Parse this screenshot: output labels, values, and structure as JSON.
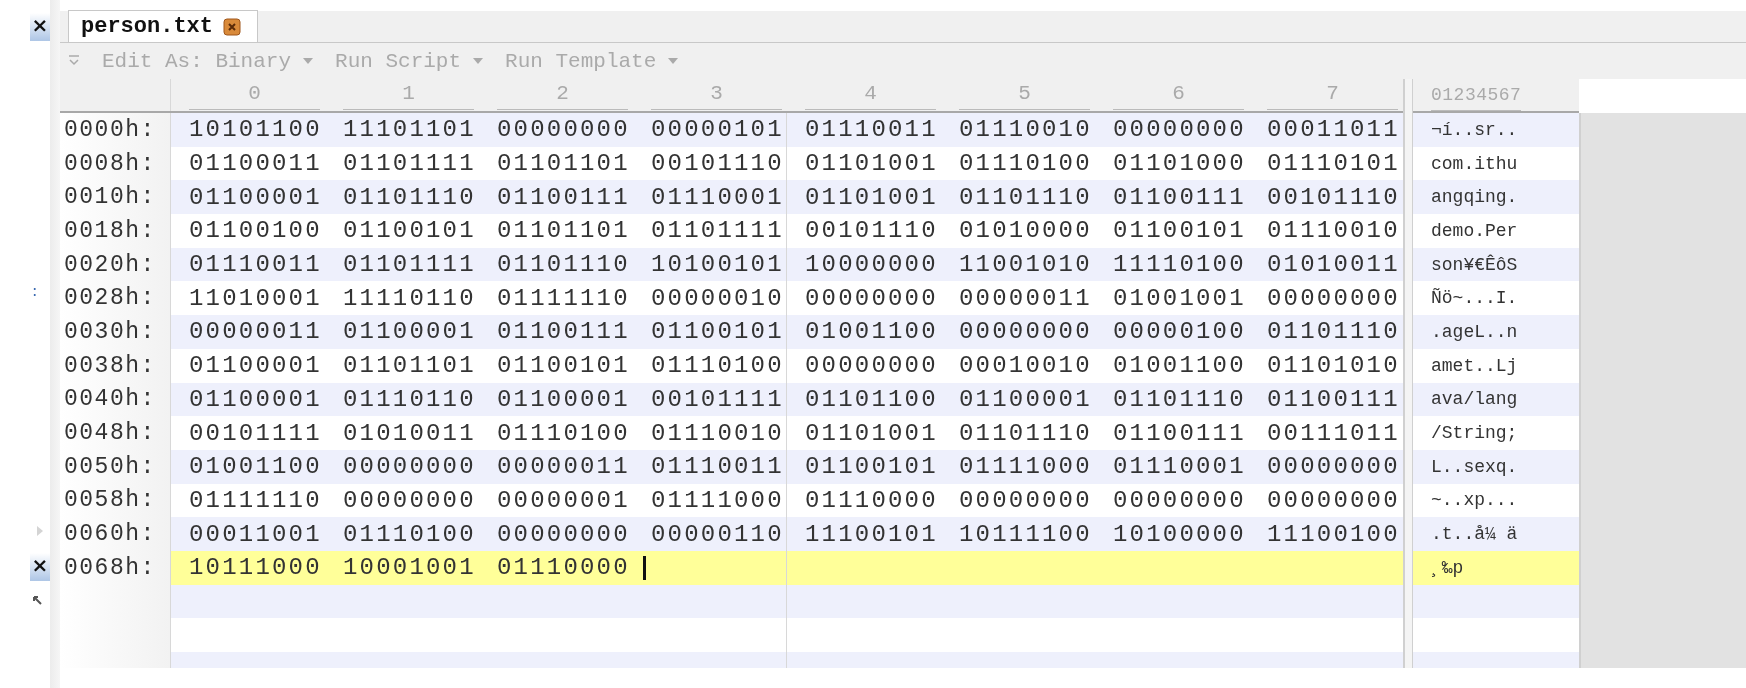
{
  "left_strip": {
    "top_button": "×",
    "splitter": ":",
    "bottom_button": "×"
  },
  "tab": {
    "title": "person.txt"
  },
  "toolbar": [
    {
      "label": "Edit As: Binary"
    },
    {
      "label": "Run Script"
    },
    {
      "label": "Run Template"
    }
  ],
  "column_header": [
    "0",
    "1",
    "2",
    "3",
    "4",
    "5",
    "6",
    "7"
  ],
  "text_header": "01234567",
  "rows": [
    {
      "address": "0000h:",
      "bytes": [
        "10101100",
        "11101101",
        "00000000",
        "00000101",
        "01110011",
        "01110010",
        "00000000",
        "00011011"
      ],
      "text": "¬í..sr..",
      "current": false
    },
    {
      "address": "0008h:",
      "bytes": [
        "01100011",
        "01101111",
        "01101101",
        "00101110",
        "01101001",
        "01110100",
        "01101000",
        "01110101"
      ],
      "text": "com.ithu",
      "current": false
    },
    {
      "address": "0010h:",
      "bytes": [
        "01100001",
        "01101110",
        "01100111",
        "01110001",
        "01101001",
        "01101110",
        "01100111",
        "00101110"
      ],
      "text": "angqing.",
      "current": false
    },
    {
      "address": "0018h:",
      "bytes": [
        "01100100",
        "01100101",
        "01101101",
        "01101111",
        "00101110",
        "01010000",
        "01100101",
        "01110010"
      ],
      "text": "demo.Per",
      "current": false
    },
    {
      "address": "0020h:",
      "bytes": [
        "01110011",
        "01101111",
        "01101110",
        "10100101",
        "10000000",
        "11001010",
        "11110100",
        "01010011"
      ],
      "text": "son¥€ÊôS",
      "current": false
    },
    {
      "address": "0028h:",
      "bytes": [
        "11010001",
        "11110110",
        "01111110",
        "00000010",
        "00000000",
        "00000011",
        "01001001",
        "00000000"
      ],
      "text": "Ñö~...I.",
      "current": false
    },
    {
      "address": "0030h:",
      "bytes": [
        "00000011",
        "01100001",
        "01100111",
        "01100101",
        "01001100",
        "00000000",
        "00000100",
        "01101110"
      ],
      "text": ".ageL..n",
      "current": false
    },
    {
      "address": "0038h:",
      "bytes": [
        "01100001",
        "01101101",
        "01100101",
        "01110100",
        "00000000",
        "00010010",
        "01001100",
        "01101010"
      ],
      "text": "amet..Lj",
      "current": false
    },
    {
      "address": "0040h:",
      "bytes": [
        "01100001",
        "01110110",
        "01100001",
        "00101111",
        "01101100",
        "01100001",
        "01101110",
        "01100111"
      ],
      "text": "ava/lang",
      "current": false
    },
    {
      "address": "0048h:",
      "bytes": [
        "00101111",
        "01010011",
        "01110100",
        "01110010",
        "01101001",
        "01101110",
        "01100111",
        "00111011"
      ],
      "text": "/String;",
      "current": false
    },
    {
      "address": "0050h:",
      "bytes": [
        "01001100",
        "00000000",
        "00000011",
        "01110011",
        "01100101",
        "01111000",
        "01110001",
        "00000000"
      ],
      "text": "L..sexq.",
      "current": false
    },
    {
      "address": "0058h:",
      "bytes": [
        "01111110",
        "00000000",
        "00000001",
        "01111000",
        "01110000",
        "00000000",
        "00000000",
        "00000000"
      ],
      "text": "~..xp...",
      "current": false
    },
    {
      "address": "0060h:",
      "bytes": [
        "00011001",
        "01110100",
        "00000000",
        "00000110",
        "11100101",
        "10111100",
        "10100000",
        "11100100"
      ],
      "text": ".t..å¼ ä",
      "current": false
    },
    {
      "address": "0068h:",
      "bytes": [
        "10111000",
        "10001001",
        "01110000"
      ],
      "text": "¸‰p",
      "current": true
    }
  ]
}
